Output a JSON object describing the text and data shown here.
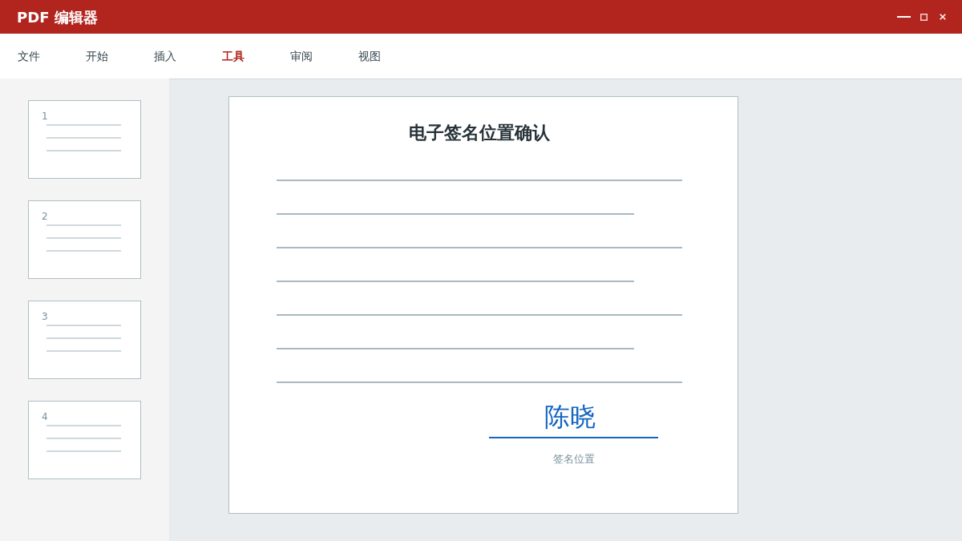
{
  "window": {
    "title": "PDF 编辑器"
  },
  "menu": [
    {
      "label": "文件",
      "selected": false
    },
    {
      "label": "开始",
      "selected": false
    },
    {
      "label": "插入",
      "selected": false
    },
    {
      "label": "工具",
      "selected": true
    },
    {
      "label": "审阅",
      "selected": false
    },
    {
      "label": "视图",
      "selected": false
    }
  ],
  "thumbnails": [
    {
      "page": "1"
    },
    {
      "page": "2"
    },
    {
      "page": "3"
    },
    {
      "page": "4"
    }
  ],
  "document": {
    "title": "电子签名位置确认",
    "signature": {
      "value": "陈晓",
      "label": "签名位置"
    }
  }
}
